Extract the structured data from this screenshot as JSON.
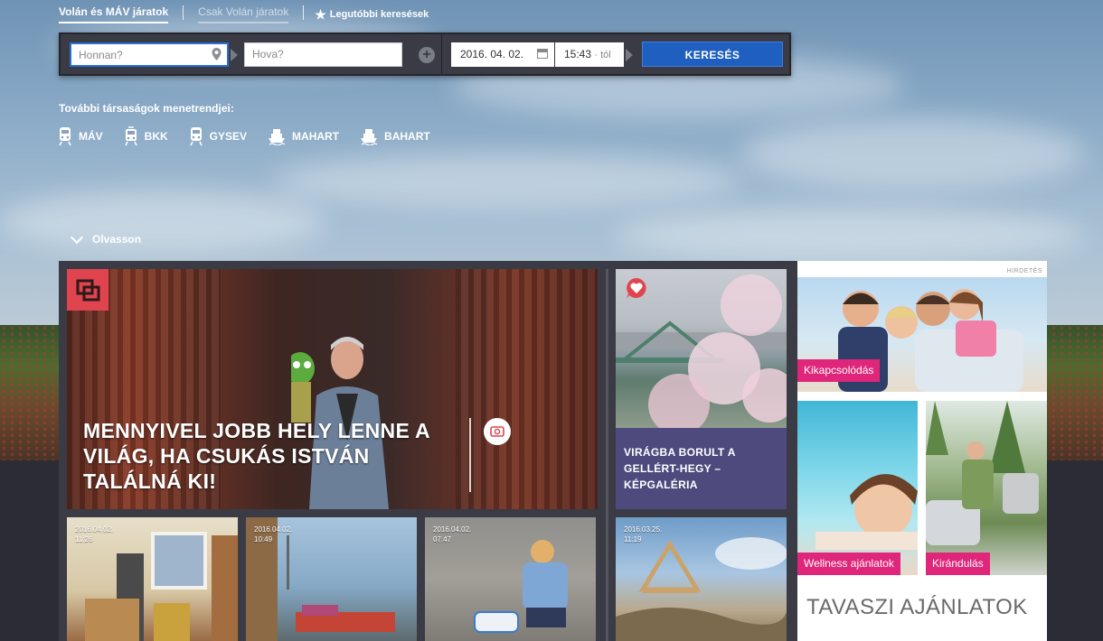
{
  "tabs": {
    "volan_mav": "Volán és MÁV járatok",
    "csak_volan": "Csak Volán járatok",
    "recent": "Legutóbbi keresések"
  },
  "search": {
    "from_placeholder": "Honnan?",
    "to_placeholder": "Hova?",
    "date": "2016. 04. 02.",
    "time": "15:43",
    "time_suffix": "· tól",
    "button": "KERESÉS"
  },
  "others_label": "További társaságok menetrendjei:",
  "companies": [
    {
      "label": "MÁV",
      "icon": "train-icon"
    },
    {
      "label": "BKK",
      "icon": "tram-icon"
    },
    {
      "label": "GYSEV",
      "icon": "train-icon"
    },
    {
      "label": "MAHART",
      "icon": "ship-icon"
    },
    {
      "label": "BAHART",
      "icon": "ship-icon"
    }
  ],
  "read_more": "Olvasson",
  "hero": {
    "title": "MENNYIVEL JOBB HELY LENNE A VILÁG, HA CSUKÁS ISTVÁN TALÁLNÁ KI!"
  },
  "side": {
    "caption": "VIRÁGBA BORULT A GELLÉRT-HEGY – KÉPGALÉRIA"
  },
  "thumbs": [
    {
      "date": "2016.04.02.",
      "time": "11:26"
    },
    {
      "date": "2016.04.02.",
      "time": "10:49"
    },
    {
      "date": "2016.04.02.",
      "time": "07:47"
    },
    {
      "date": "2016.03.25.",
      "time": "11:19"
    }
  ],
  "ad": {
    "label": "HIRDETÉS",
    "kikapcsolodas": "Kikapcsolódás",
    "wellness": "Wellness ajánlatok",
    "kirandulas": "Kirándulás",
    "title": "TAVASZI AJÁNLATOK"
  },
  "colors": {
    "accent_blue": "#1e5fc0",
    "pink": "#e0267a",
    "caption_purple": "#4e4a7e",
    "dark_panel": "#3a3b44"
  }
}
